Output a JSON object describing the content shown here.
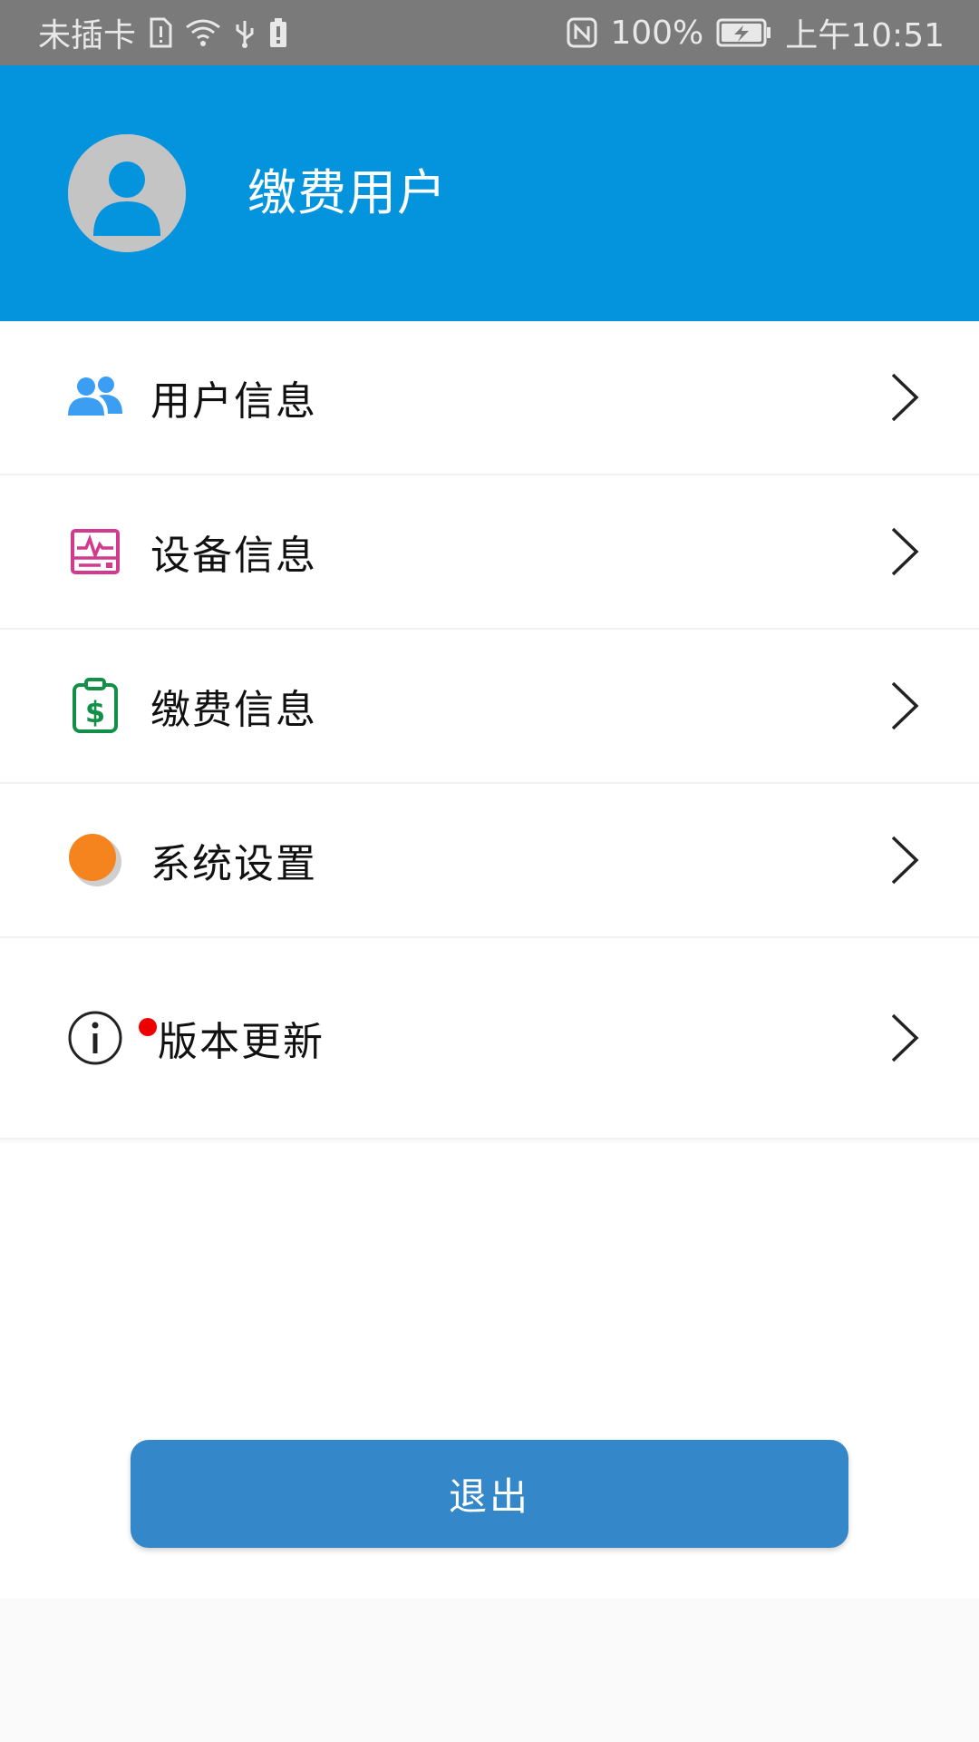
{
  "status_bar": {
    "carrier": "未插卡",
    "battery_percent": "100%",
    "time": "上午10:51"
  },
  "header": {
    "username": "缴费用户",
    "background_color": "#0494de"
  },
  "menu": {
    "items": [
      {
        "label": "用户信息",
        "icon": "users-icon"
      },
      {
        "label": "设备信息",
        "icon": "device-monitor-icon"
      },
      {
        "label": "缴费信息",
        "icon": "payment-clipboard-icon"
      },
      {
        "label": "系统设置",
        "icon": "settings-dot-icon"
      },
      {
        "label": "版本更新",
        "icon": "info-icon",
        "has_badge": true
      }
    ]
  },
  "logout": {
    "label": "退出",
    "color": "#3488ca"
  },
  "colors": {
    "badge": "#ee0000",
    "users_icon": "#3c9ef2",
    "device_icon": "#d23a8e",
    "payment_icon": "#139048",
    "settings_icon": "#f5841e"
  }
}
